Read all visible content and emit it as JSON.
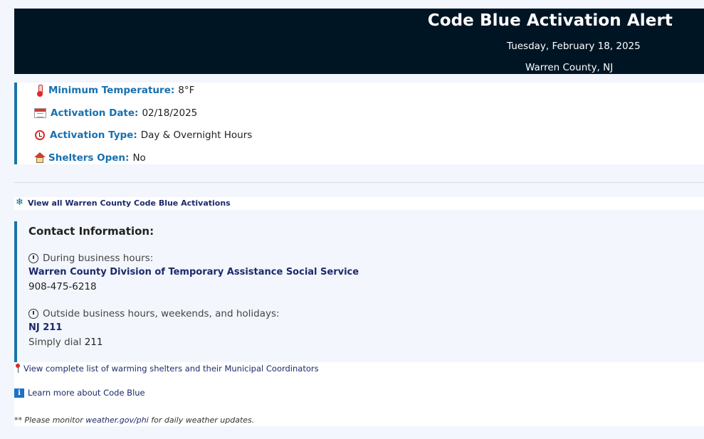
{
  "header": {
    "title": "Code Blue Activation Alert",
    "date": "Tuesday, February 18, 2025",
    "county": "Warren County, NJ"
  },
  "details": [
    {
      "icon": "thermometer-icon",
      "label": "Minimum Temperature:",
      "value": "8°F"
    },
    {
      "icon": "calendar-icon",
      "label": "Activation Date:",
      "value": "02/18/2025"
    },
    {
      "icon": "alarm-clock-icon",
      "label": "Activation Type:",
      "value": "Day & Overnight Hours"
    },
    {
      "icon": "house-icon",
      "label": "Shelters Open:",
      "value": "No"
    }
  ],
  "view_all_link": "View all Warren County Code Blue Activations",
  "contact": {
    "heading": "Contact Information:",
    "business": {
      "label": "During business hours:",
      "org": "Warren County Division of Temporary Assistance Social Service",
      "phone": "908-475-6218"
    },
    "after_hours": {
      "label": "Outside business hours, weekends, and holidays:",
      "org": "NJ 211",
      "dial_prefix": "Simply dial",
      "dial_number": "211"
    }
  },
  "links": {
    "shelters": "View complete list of warming shelters and their Municipal Coordinators",
    "learn_more": "Learn more about Code Blue"
  },
  "note": {
    "prefix": "** Please monitor",
    "link": "weather.gov/phi",
    "suffix": "for daily weather updates."
  }
}
